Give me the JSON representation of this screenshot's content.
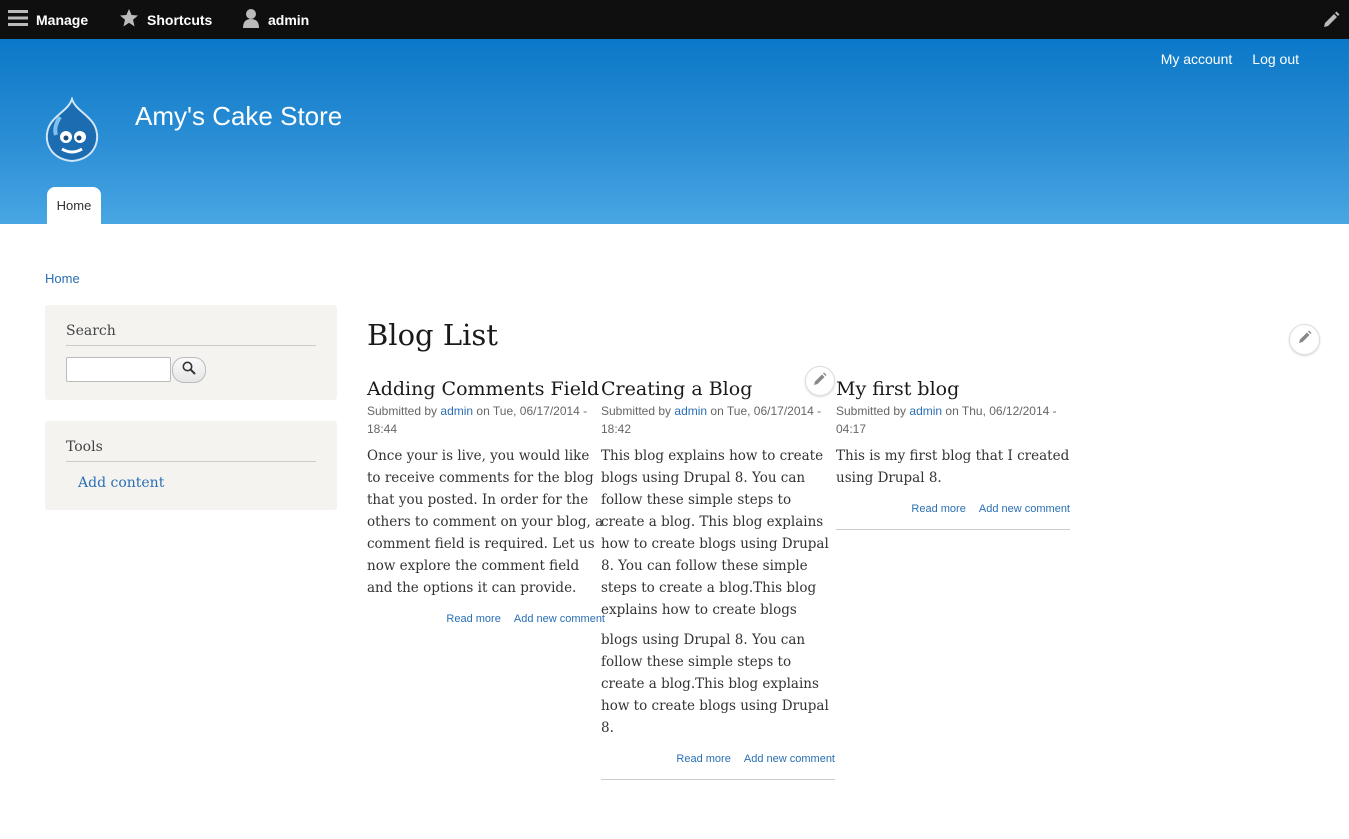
{
  "toolbar": {
    "manage": "Manage",
    "shortcuts": "Shortcuts",
    "user": "admin"
  },
  "header": {
    "secondary_menu": [
      "My account",
      "Log out"
    ],
    "site_name": "Amy's Cake Store",
    "tabs": [
      "Home"
    ]
  },
  "breadcrumb": "Home",
  "sidebar": {
    "search": {
      "title": "Search",
      "input_value": "",
      "button_icon": "search-icon"
    },
    "tools": {
      "title": "Tools",
      "links": [
        "Add content"
      ]
    }
  },
  "main": {
    "title": "Blog List",
    "posts": [
      {
        "title": "Adding Comments Field",
        "submitted_by": "Submitted by",
        "author": "admin",
        "date": "on Tue, 06/17/2014 - 18:44",
        "body": "Once your is live, you would like to receive comments for the blog that you posted. In order for the others to comment on your blog, a comment field is required. Let us now explore the comment field and the options it can provide.",
        "read_more": "Read more",
        "add_comment": "Add new comment"
      },
      {
        "title": "Creating a Blog",
        "submitted_by": "Submitted by",
        "author": "admin",
        "date": "on Tue, 06/17/2014 - 18:42",
        "body_part1": "This blog explains how to create blogs using Drupal 8. You can follow these simple steps to create a blog. This blog explains how to create blogs using Drupal 8. You can follow these simple steps to create a blog.This blog explains how to create blogs using Drupal 8. You can follow these simple steps to create a",
        "body_part2": "blogs using Drupal 8. You can follow these simple steps to create a blog.This blog explains how to create blogs using Drupal 8.",
        "read_more": "Read more",
        "add_comment": "Add new comment"
      },
      {
        "title": "My first blog",
        "submitted_by": "Submitted by",
        "author": "admin",
        "date": "on Thu, 06/12/2014 - 04:17",
        "body": "This is my first blog that I created using Drupal 8.",
        "read_more": "Read more",
        "add_comment": "Add new comment"
      }
    ]
  }
}
